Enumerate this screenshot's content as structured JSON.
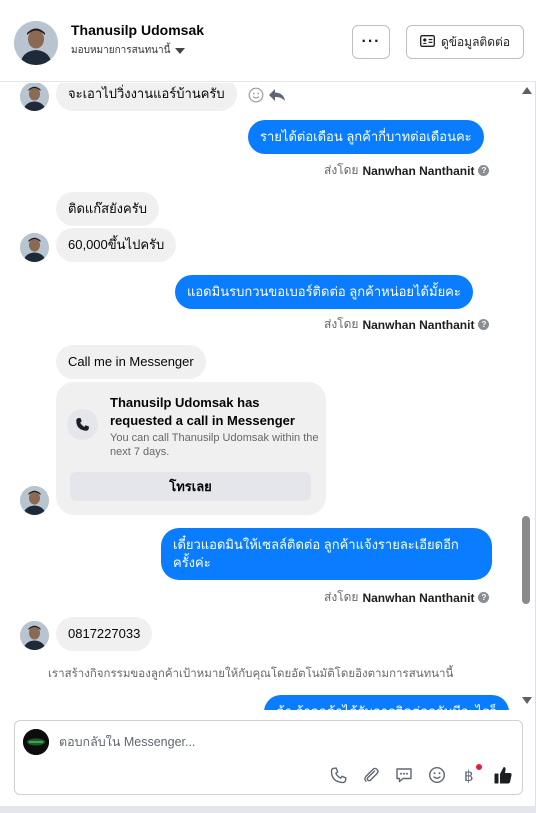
{
  "header": {
    "name": "Thanusilp Udomsak",
    "assign_label": "มอบหมายการสนทนานี้",
    "more_label": "···",
    "contact_label": "ดูข้อมูลติดต่อ"
  },
  "messages": {
    "m1": "จะเอาไปวิ่งงานแอร์บ้านครับ",
    "m2": "รายได้ต่อเดือน ลูกค้ากี่บาทต่อเดือนคะ",
    "m3": "ติดแก๊สยังครับ",
    "m4": "60,000ขึ้นไปครับ",
    "m5": "แอดมินรบกวนขอเบอร์ติดต่อ ลูกค้าหน่อยได้มั้ยคะ",
    "m6": "Call me in Messenger",
    "m7_line1": "เดี๋ยวแอดมินให้เซลล์ติดต่อ ลูกค้าแจ้งรายละเอียดอีก",
    "m7_line2": "ครั้งค่ะ",
    "m8": "0817227033",
    "m9": "ค้า ถ้าลูกค้าได้รับการติดต่อกลับมีอะไรก็"
  },
  "sent_by": {
    "prefix": "ส่งโดย",
    "agent": "Nanwhan Nanthanit"
  },
  "call_card": {
    "title": "Thanusilp Udomsak has requested a call in Messenger",
    "subtitle": "You can call Thanusilp Udomsak within the next 7 days.",
    "button": "โทรเลย"
  },
  "system_note": "เราสร้างกิจกรรมของลูกค้าเป้าหมายให้กับคุณโดยอัตโนมัติโดยอิงตามการสนทนานี้",
  "composer": {
    "placeholder": "ตอบกลับใน Messenger..."
  },
  "icons": [
    "phone-icon",
    "attachment-icon",
    "saved-replies-icon",
    "emoji-icon",
    "payment-icon",
    "like-icon"
  ],
  "colors": {
    "outgoing_bubble": "#0a7cff",
    "incoming_bubble": "#f0f0f0",
    "notification_dot": "#e41e3f"
  }
}
